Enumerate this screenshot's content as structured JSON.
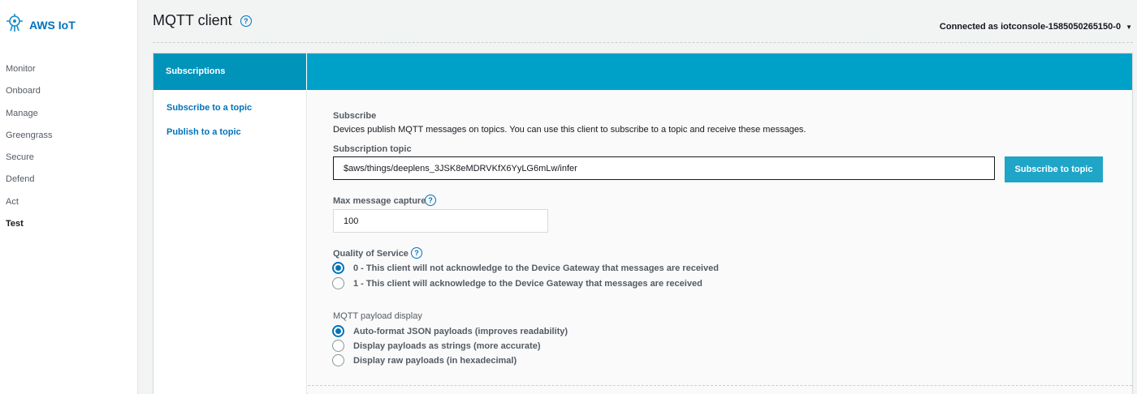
{
  "brand": {
    "name": "AWS IoT",
    "icon": "aws-iot-logo-icon"
  },
  "nav": {
    "items": [
      {
        "label": "Monitor",
        "active": false
      },
      {
        "label": "Onboard",
        "active": false
      },
      {
        "label": "Manage",
        "active": false
      },
      {
        "label": "Greengrass",
        "active": false
      },
      {
        "label": "Secure",
        "active": false
      },
      {
        "label": "Defend",
        "active": false
      },
      {
        "label": "Act",
        "active": false
      },
      {
        "label": "Test",
        "active": true
      }
    ]
  },
  "header": {
    "title": "MQTT client",
    "help_icon": "?",
    "connected_label": "Connected as iotconsole-1585050265150-0"
  },
  "panel": {
    "tab_label": "Subscriptions",
    "subnav": [
      "Subscribe to a topic",
      "Publish to a topic"
    ]
  },
  "subscribe": {
    "heading": "Subscribe",
    "description": "Devices publish MQTT messages on topics. You can use this client to subscribe to a topic and receive these messages.",
    "topic_label": "Subscription topic",
    "topic_value": "$aws/things/deeplens_3JSK8eMDRVKfX6YyLG6mLw/infer",
    "button_label": "Subscribe to topic",
    "max_label": "Max message capture",
    "max_value": "100",
    "qos_label": "Quality of Service",
    "qos_options": [
      {
        "label": "0 - This client will not acknowledge to the Device Gateway that messages are received",
        "checked": true
      },
      {
        "label": "1 - This client will acknowledge to the Device Gateway that messages are received",
        "checked": false
      }
    ],
    "payload_label": "MQTT payload display",
    "payload_options": [
      {
        "label": "Auto-format JSON payloads (improves readability)",
        "checked": true
      },
      {
        "label": "Display payloads as strings (more accurate)",
        "checked": false
      },
      {
        "label": "Display raw payloads (in hexadecimal)",
        "checked": false
      }
    ]
  },
  "colors": {
    "accent": "#00a1c9",
    "link": "#0073bb",
    "button": "#1ea5c7"
  }
}
